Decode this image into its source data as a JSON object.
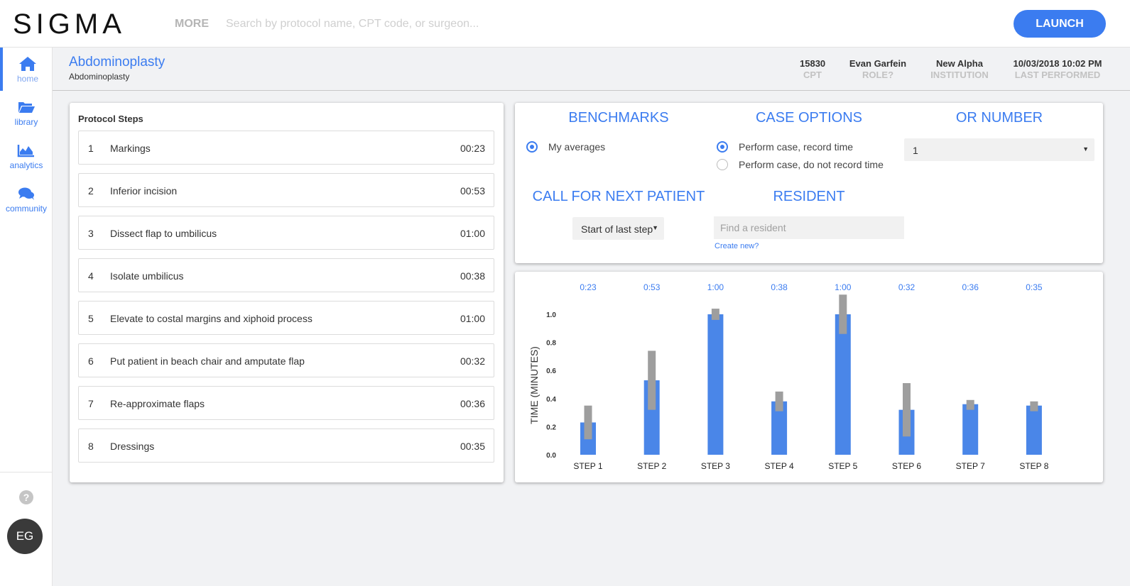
{
  "app": {
    "logo": "SIGMA",
    "more_label": "MORE",
    "search_placeholder": "Search by protocol name, CPT code, or surgeon...",
    "launch_label": "LAUNCH",
    "accent_color": "#3b7cf0"
  },
  "sidebar": {
    "items": [
      {
        "label": "home",
        "icon": "home-icon",
        "active": true
      },
      {
        "label": "library",
        "icon": "folder-open-icon",
        "active": false
      },
      {
        "label": "analytics",
        "icon": "area-chart-icon",
        "active": false
      },
      {
        "label": "community",
        "icon": "comments-icon",
        "active": false
      }
    ],
    "help_label": "?",
    "avatar_initials": "EG"
  },
  "header": {
    "title": "Abdominoplasty",
    "subtitle": "Abdominoplasty",
    "meta": [
      {
        "value": "15830",
        "key": "CPT"
      },
      {
        "value": "Evan Garfein",
        "key": "ROLE?"
      },
      {
        "value": "New Alpha",
        "key": "INSTITUTION"
      },
      {
        "value": "10/03/2018 10:02 PM",
        "key": "LAST PERFORMED"
      }
    ]
  },
  "protocol": {
    "title": "Protocol Steps",
    "steps": [
      {
        "num": "1",
        "name": "Markings",
        "time": "00:23"
      },
      {
        "num": "2",
        "name": "Inferior incision",
        "time": "00:53"
      },
      {
        "num": "3",
        "name": "Dissect flap to umbilicus",
        "time": "01:00"
      },
      {
        "num": "4",
        "name": "Isolate umbilicus",
        "time": "00:38"
      },
      {
        "num": "5",
        "name": "Elevate to costal margins and xiphoid process",
        "time": "01:00"
      },
      {
        "num": "6",
        "name": "Put patient in beach chair and amputate flap",
        "time": "00:32"
      },
      {
        "num": "7",
        "name": "Re-approximate flaps",
        "time": "00:36"
      },
      {
        "num": "8",
        "name": "Dressings",
        "time": "00:35"
      }
    ]
  },
  "options": {
    "benchmarks": {
      "heading": "BENCHMARKS",
      "choices": [
        {
          "label": "My averages",
          "selected": true
        }
      ]
    },
    "case_options": {
      "heading": "CASE OPTIONS",
      "choices": [
        {
          "label": "Perform case, record time",
          "selected": true
        },
        {
          "label": "Perform case, do not record time",
          "selected": false
        }
      ]
    },
    "or_number": {
      "heading": "OR NUMBER",
      "value": "1"
    },
    "call_next": {
      "heading": "CALL FOR NEXT PATIENT",
      "value": "Start of last step"
    },
    "resident": {
      "heading": "RESIDENT",
      "placeholder": "Find a resident",
      "create_label": "Create new?"
    }
  },
  "chart_data": {
    "type": "bar",
    "ylabel": "TIME (MINUTES)",
    "ylim": [
      0,
      1.0
    ],
    "yticks": [
      "0.0",
      "0.2",
      "0.4",
      "0.6",
      "0.8",
      "1.0"
    ],
    "categories": [
      "STEP 1",
      "STEP 2",
      "STEP 3",
      "STEP 4",
      "STEP 5",
      "STEP 6",
      "STEP 7",
      "STEP 8"
    ],
    "value_labels": [
      "0:23",
      "0:53",
      "1:00",
      "0:38",
      "1:00",
      "0:32",
      "0:36",
      "0:35"
    ],
    "values": [
      0.23,
      0.53,
      1.0,
      0.38,
      1.0,
      0.32,
      0.36,
      0.35
    ],
    "ranges": [
      [
        0.11,
        0.35
      ],
      [
        0.32,
        0.74
      ],
      [
        0.96,
        1.04
      ],
      [
        0.31,
        0.45
      ],
      [
        0.86,
        1.14
      ],
      [
        0.13,
        0.51
      ],
      [
        0.32,
        0.39
      ],
      [
        0.31,
        0.38
      ]
    ],
    "bar_color": "#4a86e8",
    "range_color": "#9e9e9e",
    "grid": false
  }
}
